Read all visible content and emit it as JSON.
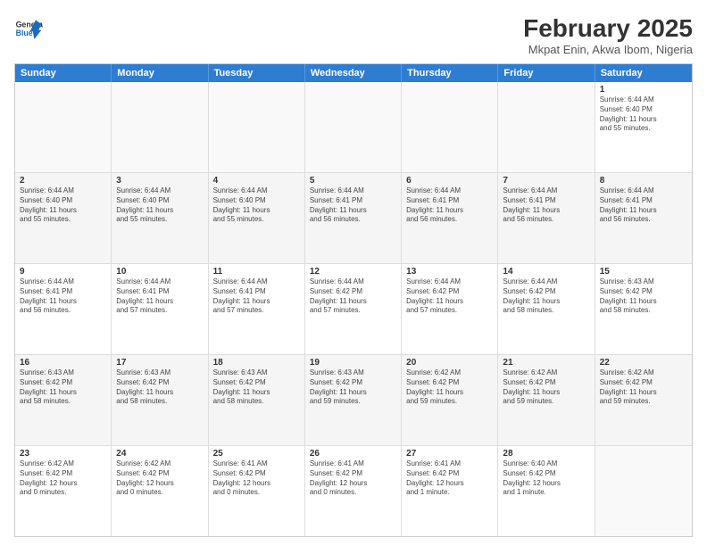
{
  "header": {
    "logo": {
      "general": "General",
      "blue": "Blue"
    },
    "title": "February 2025",
    "subtitle": "Mkpat Enin, Akwa Ibom, Nigeria"
  },
  "days_of_week": [
    "Sunday",
    "Monday",
    "Tuesday",
    "Wednesday",
    "Thursday",
    "Friday",
    "Saturday"
  ],
  "weeks": [
    [
      {
        "day": "",
        "info": ""
      },
      {
        "day": "",
        "info": ""
      },
      {
        "day": "",
        "info": ""
      },
      {
        "day": "",
        "info": ""
      },
      {
        "day": "",
        "info": ""
      },
      {
        "day": "",
        "info": ""
      },
      {
        "day": "1",
        "info": "Sunrise: 6:44 AM\nSunset: 6:40 PM\nDaylight: 11 hours\nand 55 minutes."
      }
    ],
    [
      {
        "day": "2",
        "info": "Sunrise: 6:44 AM\nSunset: 6:40 PM\nDaylight: 11 hours\nand 55 minutes."
      },
      {
        "day": "3",
        "info": "Sunrise: 6:44 AM\nSunset: 6:40 PM\nDaylight: 11 hours\nand 55 minutes."
      },
      {
        "day": "4",
        "info": "Sunrise: 6:44 AM\nSunset: 6:40 PM\nDaylight: 11 hours\nand 55 minutes."
      },
      {
        "day": "5",
        "info": "Sunrise: 6:44 AM\nSunset: 6:41 PM\nDaylight: 11 hours\nand 56 minutes."
      },
      {
        "day": "6",
        "info": "Sunrise: 6:44 AM\nSunset: 6:41 PM\nDaylight: 11 hours\nand 56 minutes."
      },
      {
        "day": "7",
        "info": "Sunrise: 6:44 AM\nSunset: 6:41 PM\nDaylight: 11 hours\nand 56 minutes."
      },
      {
        "day": "8",
        "info": "Sunrise: 6:44 AM\nSunset: 6:41 PM\nDaylight: 11 hours\nand 56 minutes."
      }
    ],
    [
      {
        "day": "9",
        "info": "Sunrise: 6:44 AM\nSunset: 6:41 PM\nDaylight: 11 hours\nand 56 minutes."
      },
      {
        "day": "10",
        "info": "Sunrise: 6:44 AM\nSunset: 6:41 PM\nDaylight: 11 hours\nand 57 minutes."
      },
      {
        "day": "11",
        "info": "Sunrise: 6:44 AM\nSunset: 6:41 PM\nDaylight: 11 hours\nand 57 minutes."
      },
      {
        "day": "12",
        "info": "Sunrise: 6:44 AM\nSunset: 6:42 PM\nDaylight: 11 hours\nand 57 minutes."
      },
      {
        "day": "13",
        "info": "Sunrise: 6:44 AM\nSunset: 6:42 PM\nDaylight: 11 hours\nand 57 minutes."
      },
      {
        "day": "14",
        "info": "Sunrise: 6:44 AM\nSunset: 6:42 PM\nDaylight: 11 hours\nand 58 minutes."
      },
      {
        "day": "15",
        "info": "Sunrise: 6:43 AM\nSunset: 6:42 PM\nDaylight: 11 hours\nand 58 minutes."
      }
    ],
    [
      {
        "day": "16",
        "info": "Sunrise: 6:43 AM\nSunset: 6:42 PM\nDaylight: 11 hours\nand 58 minutes."
      },
      {
        "day": "17",
        "info": "Sunrise: 6:43 AM\nSunset: 6:42 PM\nDaylight: 11 hours\nand 58 minutes."
      },
      {
        "day": "18",
        "info": "Sunrise: 6:43 AM\nSunset: 6:42 PM\nDaylight: 11 hours\nand 58 minutes."
      },
      {
        "day": "19",
        "info": "Sunrise: 6:43 AM\nSunset: 6:42 PM\nDaylight: 11 hours\nand 59 minutes."
      },
      {
        "day": "20",
        "info": "Sunrise: 6:42 AM\nSunset: 6:42 PM\nDaylight: 11 hours\nand 59 minutes."
      },
      {
        "day": "21",
        "info": "Sunrise: 6:42 AM\nSunset: 6:42 PM\nDaylight: 11 hours\nand 59 minutes."
      },
      {
        "day": "22",
        "info": "Sunrise: 6:42 AM\nSunset: 6:42 PM\nDaylight: 11 hours\nand 59 minutes."
      }
    ],
    [
      {
        "day": "23",
        "info": "Sunrise: 6:42 AM\nSunset: 6:42 PM\nDaylight: 12 hours\nand 0 minutes."
      },
      {
        "day": "24",
        "info": "Sunrise: 6:42 AM\nSunset: 6:42 PM\nDaylight: 12 hours\nand 0 minutes."
      },
      {
        "day": "25",
        "info": "Sunrise: 6:41 AM\nSunset: 6:42 PM\nDaylight: 12 hours\nand 0 minutes."
      },
      {
        "day": "26",
        "info": "Sunrise: 6:41 AM\nSunset: 6:42 PM\nDaylight: 12 hours\nand 0 minutes."
      },
      {
        "day": "27",
        "info": "Sunrise: 6:41 AM\nSunset: 6:42 PM\nDaylight: 12 hours\nand 1 minute."
      },
      {
        "day": "28",
        "info": "Sunrise: 6:40 AM\nSunset: 6:42 PM\nDaylight: 12 hours\nand 1 minute."
      },
      {
        "day": "",
        "info": ""
      }
    ]
  ]
}
